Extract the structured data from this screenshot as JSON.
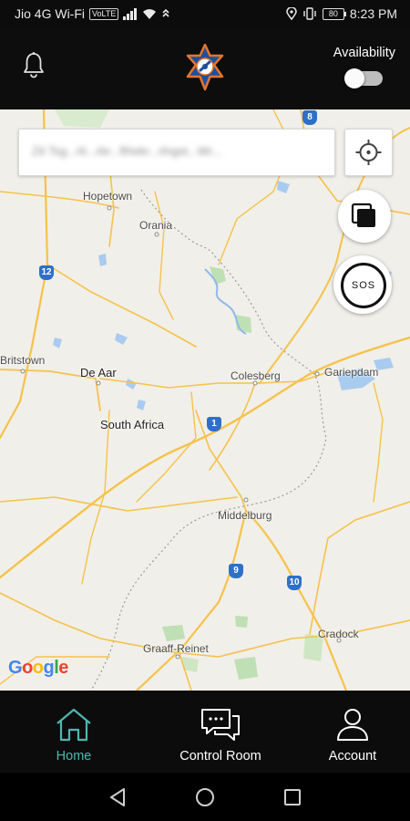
{
  "status_bar": {
    "carrier": "Jio 4G Wi-Fi",
    "volte_badge": "VoLTE",
    "battery": "80",
    "time": "8:23 PM"
  },
  "header": {
    "availability_label": "Availability",
    "availability_on": false
  },
  "search": {
    "value": "Zit Tsg...rlr...rbr...fthekr...rlngst...Wr..."
  },
  "map": {
    "places": {
      "hopetown": "Hopetown",
      "orania": "Orania",
      "britstown": "Britstown",
      "de_aar": "De Aar",
      "south_africa": "South Africa",
      "colesberg": "Colesberg",
      "gariepdam": "Gariepdam",
      "middelburg": "Middelburg",
      "cradock": "Cradock",
      "graaff_reinet": "Graaff-Reinet"
    },
    "routes": [
      "8",
      "12",
      "1",
      "9",
      "10"
    ],
    "attribution": "Google"
  },
  "sos_label": "SOS",
  "bottom_nav": {
    "home": "Home",
    "control_room": "Control Room",
    "account": "Account",
    "active_color": "#4fb7b2"
  },
  "colors": {
    "bar_bg": "#0c0c0c",
    "route_shield": "#2f6fc9",
    "road": "#f5c24a"
  }
}
